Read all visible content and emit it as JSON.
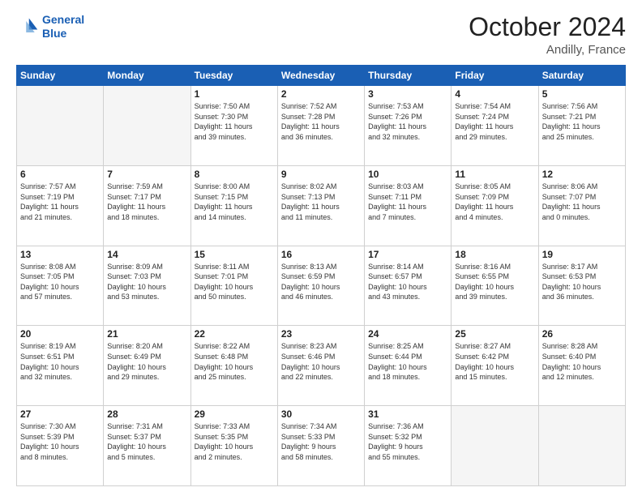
{
  "header": {
    "logo_line1": "General",
    "logo_line2": "Blue",
    "month": "October 2024",
    "location": "Andilly, France"
  },
  "days_of_week": [
    "Sunday",
    "Monday",
    "Tuesday",
    "Wednesday",
    "Thursday",
    "Friday",
    "Saturday"
  ],
  "weeks": [
    [
      {
        "day": "",
        "content": "",
        "empty": true
      },
      {
        "day": "",
        "content": "",
        "empty": true
      },
      {
        "day": "1",
        "content": "Sunrise: 7:50 AM\nSunset: 7:30 PM\nDaylight: 11 hours\nand 39 minutes.",
        "empty": false
      },
      {
        "day": "2",
        "content": "Sunrise: 7:52 AM\nSunset: 7:28 PM\nDaylight: 11 hours\nand 36 minutes.",
        "empty": false
      },
      {
        "day": "3",
        "content": "Sunrise: 7:53 AM\nSunset: 7:26 PM\nDaylight: 11 hours\nand 32 minutes.",
        "empty": false
      },
      {
        "day": "4",
        "content": "Sunrise: 7:54 AM\nSunset: 7:24 PM\nDaylight: 11 hours\nand 29 minutes.",
        "empty": false
      },
      {
        "day": "5",
        "content": "Sunrise: 7:56 AM\nSunset: 7:21 PM\nDaylight: 11 hours\nand 25 minutes.",
        "empty": false
      }
    ],
    [
      {
        "day": "6",
        "content": "Sunrise: 7:57 AM\nSunset: 7:19 PM\nDaylight: 11 hours\nand 21 minutes.",
        "empty": false
      },
      {
        "day": "7",
        "content": "Sunrise: 7:59 AM\nSunset: 7:17 PM\nDaylight: 11 hours\nand 18 minutes.",
        "empty": false
      },
      {
        "day": "8",
        "content": "Sunrise: 8:00 AM\nSunset: 7:15 PM\nDaylight: 11 hours\nand 14 minutes.",
        "empty": false
      },
      {
        "day": "9",
        "content": "Sunrise: 8:02 AM\nSunset: 7:13 PM\nDaylight: 11 hours\nand 11 minutes.",
        "empty": false
      },
      {
        "day": "10",
        "content": "Sunrise: 8:03 AM\nSunset: 7:11 PM\nDaylight: 11 hours\nand 7 minutes.",
        "empty": false
      },
      {
        "day": "11",
        "content": "Sunrise: 8:05 AM\nSunset: 7:09 PM\nDaylight: 11 hours\nand 4 minutes.",
        "empty": false
      },
      {
        "day": "12",
        "content": "Sunrise: 8:06 AM\nSunset: 7:07 PM\nDaylight: 11 hours\nand 0 minutes.",
        "empty": false
      }
    ],
    [
      {
        "day": "13",
        "content": "Sunrise: 8:08 AM\nSunset: 7:05 PM\nDaylight: 10 hours\nand 57 minutes.",
        "empty": false
      },
      {
        "day": "14",
        "content": "Sunrise: 8:09 AM\nSunset: 7:03 PM\nDaylight: 10 hours\nand 53 minutes.",
        "empty": false
      },
      {
        "day": "15",
        "content": "Sunrise: 8:11 AM\nSunset: 7:01 PM\nDaylight: 10 hours\nand 50 minutes.",
        "empty": false
      },
      {
        "day": "16",
        "content": "Sunrise: 8:13 AM\nSunset: 6:59 PM\nDaylight: 10 hours\nand 46 minutes.",
        "empty": false
      },
      {
        "day": "17",
        "content": "Sunrise: 8:14 AM\nSunset: 6:57 PM\nDaylight: 10 hours\nand 43 minutes.",
        "empty": false
      },
      {
        "day": "18",
        "content": "Sunrise: 8:16 AM\nSunset: 6:55 PM\nDaylight: 10 hours\nand 39 minutes.",
        "empty": false
      },
      {
        "day": "19",
        "content": "Sunrise: 8:17 AM\nSunset: 6:53 PM\nDaylight: 10 hours\nand 36 minutes.",
        "empty": false
      }
    ],
    [
      {
        "day": "20",
        "content": "Sunrise: 8:19 AM\nSunset: 6:51 PM\nDaylight: 10 hours\nand 32 minutes.",
        "empty": false
      },
      {
        "day": "21",
        "content": "Sunrise: 8:20 AM\nSunset: 6:49 PM\nDaylight: 10 hours\nand 29 minutes.",
        "empty": false
      },
      {
        "day": "22",
        "content": "Sunrise: 8:22 AM\nSunset: 6:48 PM\nDaylight: 10 hours\nand 25 minutes.",
        "empty": false
      },
      {
        "day": "23",
        "content": "Sunrise: 8:23 AM\nSunset: 6:46 PM\nDaylight: 10 hours\nand 22 minutes.",
        "empty": false
      },
      {
        "day": "24",
        "content": "Sunrise: 8:25 AM\nSunset: 6:44 PM\nDaylight: 10 hours\nand 18 minutes.",
        "empty": false
      },
      {
        "day": "25",
        "content": "Sunrise: 8:27 AM\nSunset: 6:42 PM\nDaylight: 10 hours\nand 15 minutes.",
        "empty": false
      },
      {
        "day": "26",
        "content": "Sunrise: 8:28 AM\nSunset: 6:40 PM\nDaylight: 10 hours\nand 12 minutes.",
        "empty": false
      }
    ],
    [
      {
        "day": "27",
        "content": "Sunrise: 7:30 AM\nSunset: 5:39 PM\nDaylight: 10 hours\nand 8 minutes.",
        "empty": false
      },
      {
        "day": "28",
        "content": "Sunrise: 7:31 AM\nSunset: 5:37 PM\nDaylight: 10 hours\nand 5 minutes.",
        "empty": false
      },
      {
        "day": "29",
        "content": "Sunrise: 7:33 AM\nSunset: 5:35 PM\nDaylight: 10 hours\nand 2 minutes.",
        "empty": false
      },
      {
        "day": "30",
        "content": "Sunrise: 7:34 AM\nSunset: 5:33 PM\nDaylight: 9 hours\nand 58 minutes.",
        "empty": false
      },
      {
        "day": "31",
        "content": "Sunrise: 7:36 AM\nSunset: 5:32 PM\nDaylight: 9 hours\nand 55 minutes.",
        "empty": false
      },
      {
        "day": "",
        "content": "",
        "empty": true
      },
      {
        "day": "",
        "content": "",
        "empty": true
      }
    ]
  ]
}
